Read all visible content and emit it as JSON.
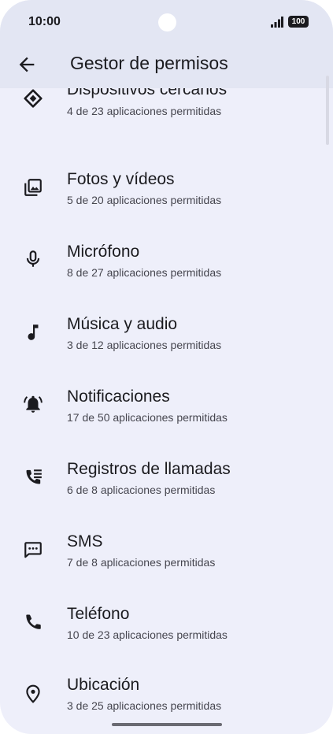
{
  "status_bar": {
    "time": "10:00",
    "battery": "100"
  },
  "app_bar": {
    "title": "Gestor de permisos",
    "back_icon": "arrow-back-icon"
  },
  "permissions": [
    {
      "label": "Dispositivos cercanos",
      "detail": "4 de 23 aplicaciones permitidas",
      "icon": "nearby-devices-icon"
    },
    {
      "label": "Fotos y vídeos",
      "detail": "5 de 20 aplicaciones permitidas",
      "icon": "photos-icon"
    },
    {
      "label": "Micrófono",
      "detail": "8 de 27 aplicaciones permitidas",
      "icon": "microphone-icon"
    },
    {
      "label": "Música y audio",
      "detail": "3 de 12 aplicaciones permitidas",
      "icon": "music-note-icon"
    },
    {
      "label": "Notificaciones",
      "detail": "17 de 50 aplicaciones permitidas",
      "icon": "bell-icon"
    },
    {
      "label": "Registros de llamadas",
      "detail": "6 de 8 aplicaciones permitidas",
      "icon": "call-log-icon"
    },
    {
      "label": "SMS",
      "detail": "7 de 8 aplicaciones permitidas",
      "icon": "sms-icon"
    },
    {
      "label": "Teléfono",
      "detail": "10 de 23 aplicaciones permitidas",
      "icon": "phone-icon"
    },
    {
      "label": "Ubicación",
      "detail": "3 de 25 aplicaciones permitidas",
      "icon": "location-pin-icon"
    }
  ],
  "colors": {
    "background": "#eeeffa",
    "app_bar": "#e3e6f3",
    "primary_text": "#1b1b1f",
    "secondary_text": "#46464f"
  }
}
